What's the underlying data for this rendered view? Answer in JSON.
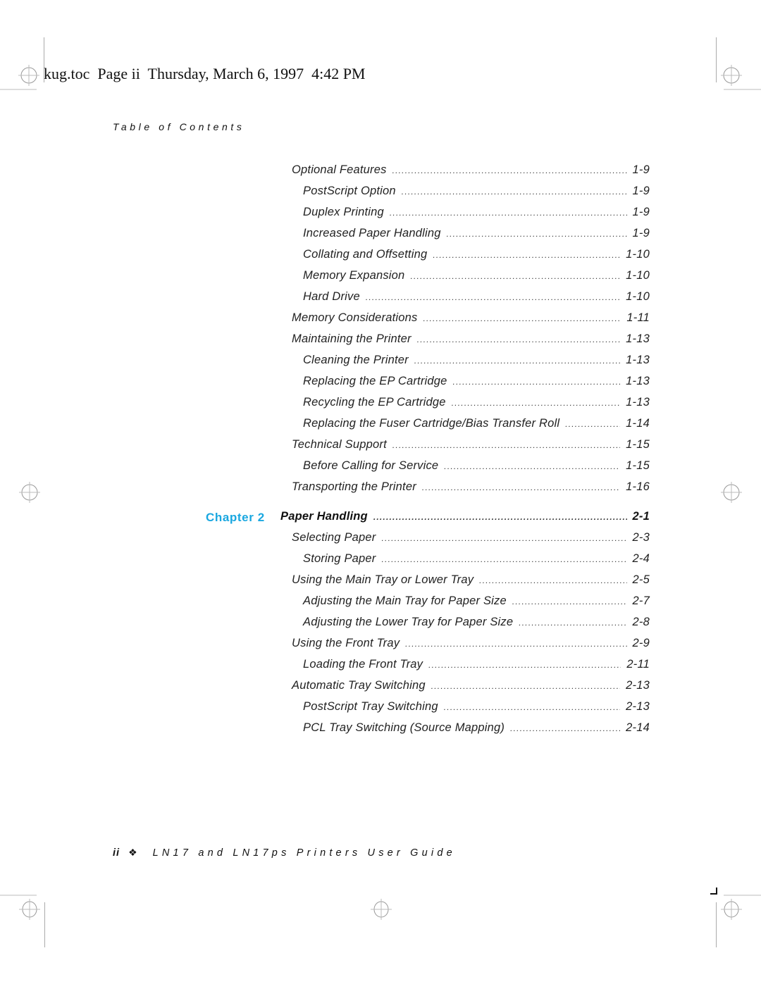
{
  "header": {
    "filename": "kug.toc",
    "page_label": "Page ii",
    "timestamp": "Thursday, March 6, 1997  4:42 PM"
  },
  "section_title": "Table of Contents",
  "chapter": {
    "label": "Chapter 2",
    "title": "Paper Handling",
    "page": "2-1",
    "accent_color": "#1aa7e0"
  },
  "entries_before_chapter": [
    {
      "title": "Optional Features",
      "page": "1-9",
      "level": 1
    },
    {
      "title": "PostScript Option",
      "page": "1-9",
      "level": 2
    },
    {
      "title": "Duplex Printing",
      "page": "1-9",
      "level": 2
    },
    {
      "title": "Increased Paper Handling",
      "page": "1-9",
      "level": 2
    },
    {
      "title": "Collating and Offsetting",
      "page": "1-10",
      "level": 2
    },
    {
      "title": "Memory Expansion",
      "page": "1-10",
      "level": 2
    },
    {
      "title": "Hard Drive",
      "page": "1-10",
      "level": 2
    },
    {
      "title": "Memory Considerations",
      "page": "1-11",
      "level": 1
    },
    {
      "title": "Maintaining the Printer",
      "page": "1-13",
      "level": 1
    },
    {
      "title": "Cleaning the Printer",
      "page": "1-13",
      "level": 2
    },
    {
      "title": "Replacing the EP Cartridge",
      "page": "1-13",
      "level": 2
    },
    {
      "title": "Recycling the EP Cartridge",
      "page": "1-13",
      "level": 2
    },
    {
      "title": "Replacing the Fuser Cartridge/Bias Transfer Roll",
      "page": "1-14",
      "level": 2
    },
    {
      "title": "Technical Support",
      "page": "1-15",
      "level": 1
    },
    {
      "title": "Before Calling for Service",
      "page": "1-15",
      "level": 2
    },
    {
      "title": "Transporting the Printer",
      "page": "1-16",
      "level": 1
    }
  ],
  "entries_after_chapter": [
    {
      "title": "Selecting Paper",
      "page": "2-3",
      "level": 1
    },
    {
      "title": "Storing Paper",
      "page": "2-4",
      "level": 2
    },
    {
      "title": "Using the Main Tray or Lower Tray",
      "page": "2-5",
      "level": 1
    },
    {
      "title": "Adjusting the Main Tray for Paper Size",
      "page": "2-7",
      "level": 2
    },
    {
      "title": "Adjusting the Lower Tray for Paper Size",
      "page": "2-8",
      "level": 2
    },
    {
      "title": "Using the Front Tray",
      "page": "2-9",
      "level": 1
    },
    {
      "title": "Loading the Front Tray",
      "page": "2-11",
      "level": 2
    },
    {
      "title": "Automatic Tray Switching",
      "page": "2-13",
      "level": 1
    },
    {
      "title": "PostScript Tray Switching",
      "page": "2-13",
      "level": 2
    },
    {
      "title": "PCL Tray Switching (Source Mapping)",
      "page": "2-14",
      "level": 2
    }
  ],
  "footer": {
    "page_number": "ii",
    "ornament": "❖",
    "book_title": "LN17 and LN17ps Printers User Guide"
  }
}
